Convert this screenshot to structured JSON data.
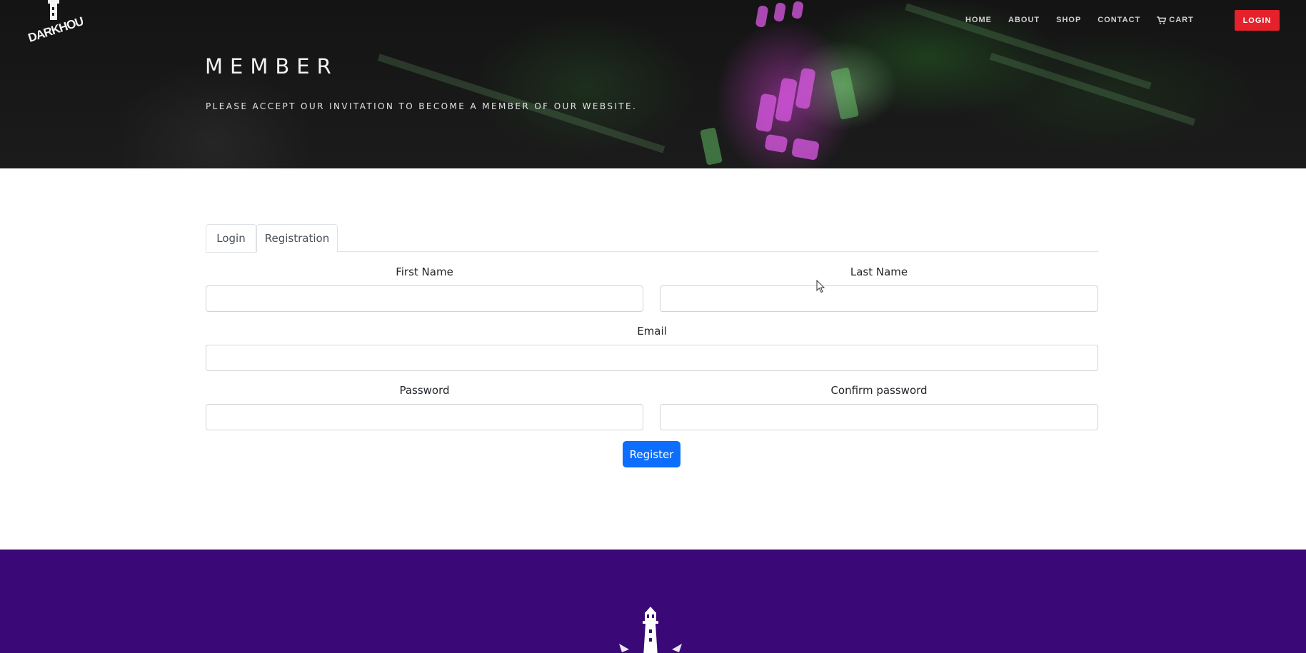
{
  "header": {
    "logo_alt": "DARKHOUSE",
    "nav": [
      {
        "label": "HOME"
      },
      {
        "label": "ABOUT"
      },
      {
        "label": "SHOP"
      },
      {
        "label": "CONTACT"
      }
    ],
    "cart_label": "CART",
    "login_label": "LOGIN"
  },
  "hero": {
    "title": "MEMBER",
    "subtitle": "PLEASE ACCEPT OUR INVITATION TO BECOME A MEMBER OF OUR WEBSITE."
  },
  "form": {
    "tabs": [
      {
        "label": "Login",
        "active": false
      },
      {
        "label": "Registration",
        "active": true
      }
    ],
    "fields": {
      "first_name": {
        "label": "First Name",
        "value": ""
      },
      "last_name": {
        "label": "Last Name",
        "value": ""
      },
      "email": {
        "label": "Email",
        "value": ""
      },
      "password": {
        "label": "Password",
        "value": ""
      },
      "confirm_password": {
        "label": "Confirm password",
        "value": ""
      }
    },
    "submit_label": "Register"
  },
  "colors": {
    "accent_red": "#e5222b",
    "primary_blue": "#0d6efd",
    "footer_purple": "#3b0877",
    "hero_dark": "#161616"
  },
  "icons": {
    "cart": "cart-icon",
    "logo": "lighthouse-logo",
    "footer_logo": "lighthouse-logo",
    "cursor": "mouse-cursor"
  }
}
